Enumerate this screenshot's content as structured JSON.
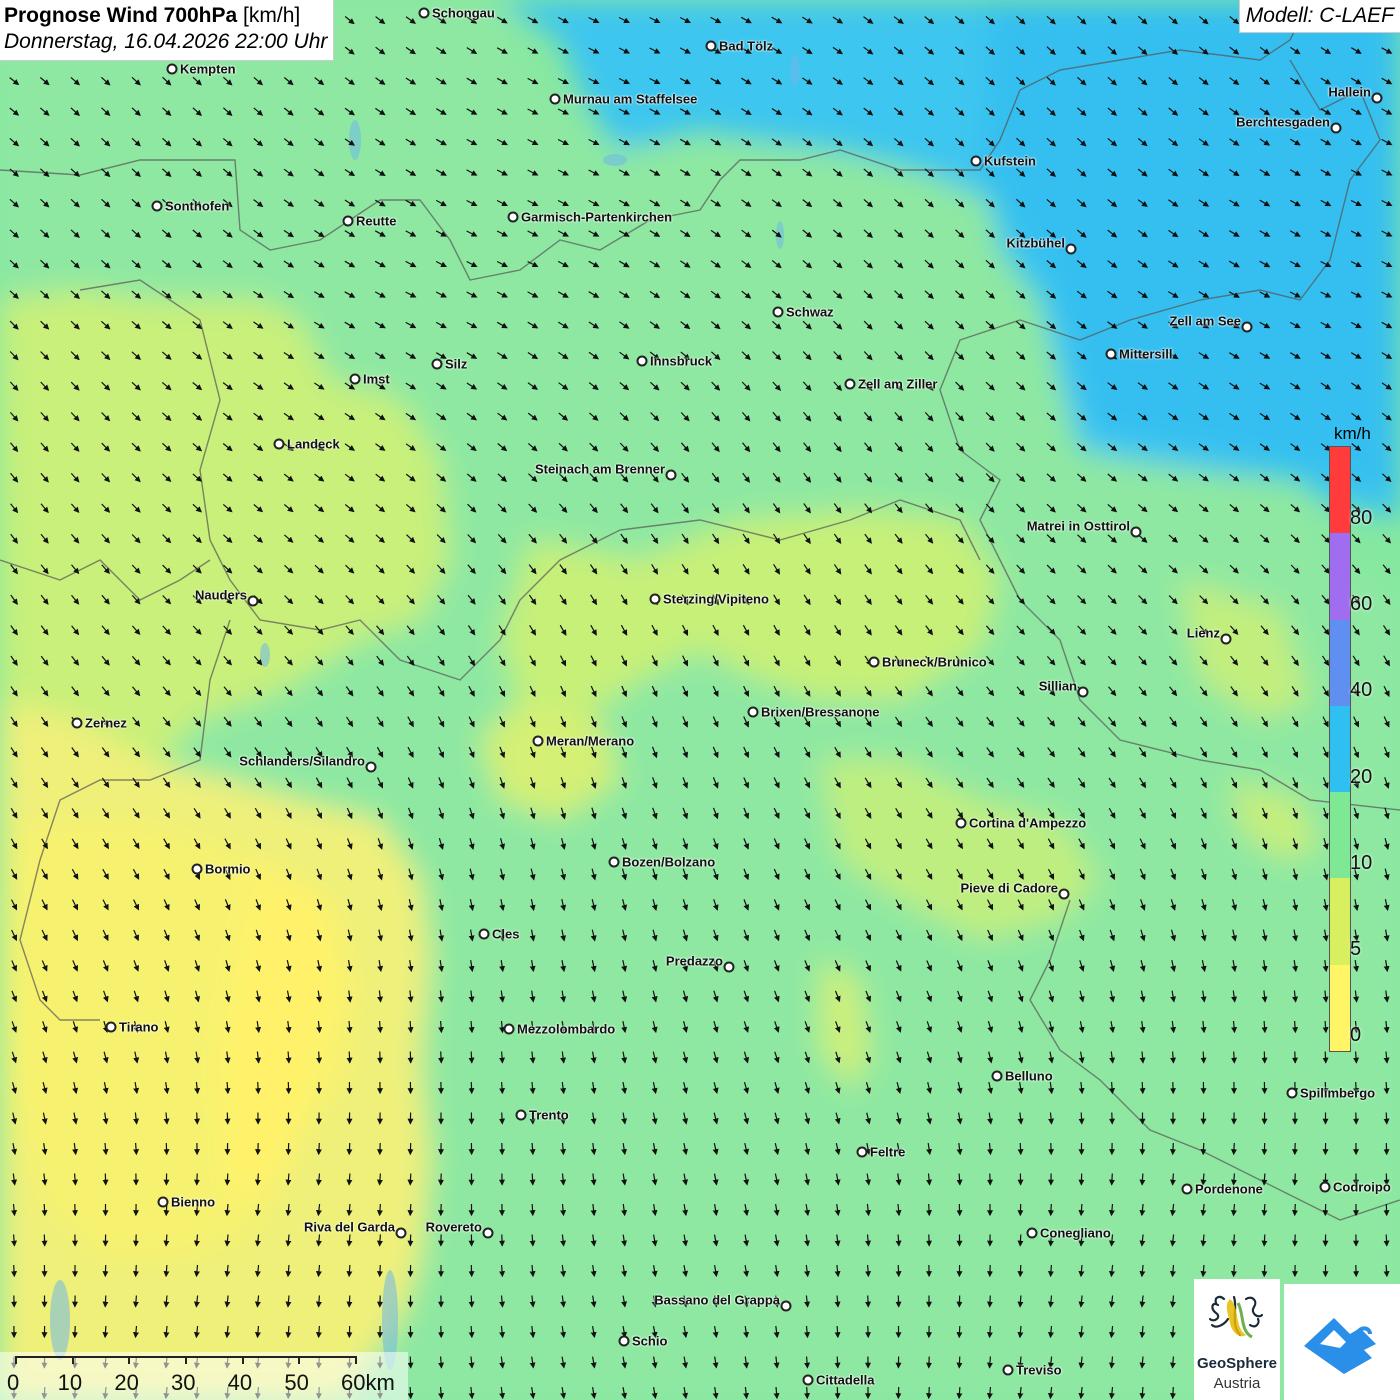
{
  "header": {
    "title_bold": "Prognose Wind 700hPa",
    "title_unit": "[km/h]",
    "datetime": "Donnerstag, 16.04.2026 22:00 Uhr",
    "model": "Modell: C-LAEF"
  },
  "legend": {
    "unit": "km/h",
    "ticks": [
      "80",
      "60",
      "40",
      "20",
      "10",
      "5",
      "0"
    ],
    "colors": [
      "#ff3b3b",
      "#a06cf0",
      "#5f8ff0",
      "#2fbff0",
      "#7ee895",
      "#d8f060",
      "#fff566"
    ]
  },
  "scalebar": {
    "labels": [
      "0",
      "10",
      "20",
      "30",
      "40",
      "50",
      "60km"
    ]
  },
  "logos": {
    "geosphere_line1": "GeoSphere",
    "geosphere_line2": "Austria"
  },
  "cities": [
    {
      "name": "Schongau",
      "side": "right"
    },
    {
      "name": "Bad Tölz",
      "side": "right"
    },
    {
      "name": "Kempten",
      "side": "right"
    },
    {
      "name": "Murnau am Staffelsee",
      "side": "right"
    },
    {
      "name": "Hallein",
      "side": "left"
    },
    {
      "name": "Berchtesgaden",
      "side": "left"
    },
    {
      "name": "Kufstein",
      "side": "right"
    },
    {
      "name": "Sonthofen",
      "side": "right"
    },
    {
      "name": "Reutte",
      "side": "right"
    },
    {
      "name": "Garmisch-Partenkirchen",
      "side": "right"
    },
    {
      "name": "Kitzbühel",
      "side": "left"
    },
    {
      "name": "Schwaz",
      "side": "right"
    },
    {
      "name": "Zell am See",
      "side": "left"
    },
    {
      "name": "Mittersill",
      "side": "right"
    },
    {
      "name": "Innsbruck",
      "side": "right"
    },
    {
      "name": "Silz",
      "side": "right"
    },
    {
      "name": "Imst",
      "side": "right"
    },
    {
      "name": "Zell am Ziller",
      "side": "right"
    },
    {
      "name": "Landeck",
      "side": "right"
    },
    {
      "name": "Steinach am Brenner",
      "side": "left"
    },
    {
      "name": "Matrei in Osttirol",
      "side": "left"
    },
    {
      "name": "Nauders",
      "side": "left"
    },
    {
      "name": "Sterzing/Vipiteno",
      "side": "right"
    },
    {
      "name": "Lienz",
      "side": "left"
    },
    {
      "name": "Bruneck/Brunico",
      "side": "right"
    },
    {
      "name": "Sillian",
      "side": "left"
    },
    {
      "name": "Brixen/Bressanone",
      "side": "right"
    },
    {
      "name": "Zernez",
      "side": "right"
    },
    {
      "name": "Meran/Merano",
      "side": "right"
    },
    {
      "name": "Schlanders/Silandro",
      "side": "left"
    },
    {
      "name": "Cortina d'Ampezzo",
      "side": "right"
    },
    {
      "name": "Bozen/Bolzano",
      "side": "right"
    },
    {
      "name": "Bormio",
      "side": "right"
    },
    {
      "name": "Pieve di Cadore",
      "side": "left"
    },
    {
      "name": "Cles",
      "side": "right"
    },
    {
      "name": "Predazzo",
      "side": "left"
    },
    {
      "name": "Tirano",
      "side": "right"
    },
    {
      "name": "Mezzolombardo",
      "side": "right"
    },
    {
      "name": "Belluno",
      "side": "right"
    },
    {
      "name": "Spilimbergo",
      "side": "right"
    },
    {
      "name": "Trento",
      "side": "right"
    },
    {
      "name": "Feltre",
      "side": "right"
    },
    {
      "name": "Pordenone",
      "side": "right"
    },
    {
      "name": "Codroipo",
      "side": "right"
    },
    {
      "name": "Bienno",
      "side": "right"
    },
    {
      "name": "Riva del Garda",
      "side": "left"
    },
    {
      "name": "Rovereto",
      "side": "left"
    },
    {
      "name": "Conegliano",
      "side": "right"
    },
    {
      "name": "Bassano del Grappa",
      "side": "left"
    },
    {
      "name": "Schio",
      "side": "right"
    },
    {
      "name": "Treviso",
      "side": "right"
    },
    {
      "name": "Cittadella",
      "side": "right"
    }
  ]
}
